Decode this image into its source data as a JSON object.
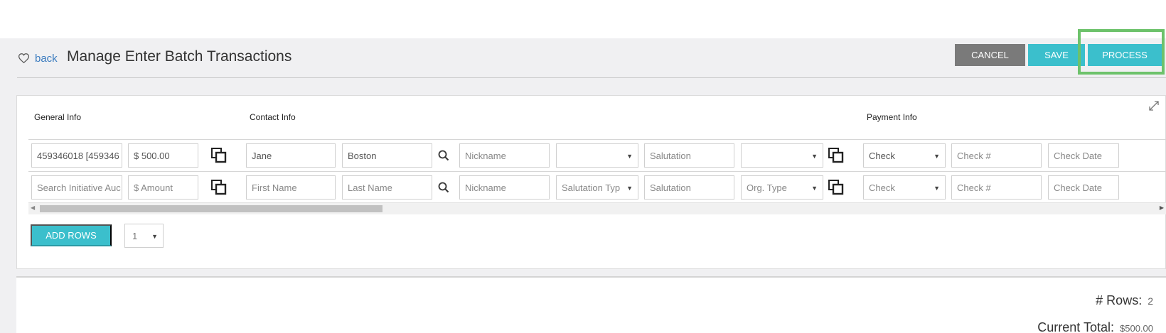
{
  "header": {
    "back_label": "back",
    "title": "Manage Enter Batch Transactions",
    "cancel_label": "CANCEL",
    "save_label": "SAVE",
    "process_label": "PROCESS"
  },
  "sections": {
    "general": "General Info",
    "contact": "Contact Info",
    "payment": "Payment Info"
  },
  "rows": [
    {
      "initiative": "459346018 [459346",
      "amount": "$ 500.00",
      "first_name": "Jane",
      "last_name": "Boston",
      "nickname": "Nickname",
      "salutation_type": "",
      "salutation": "Salutation",
      "org_type": "",
      "payment_type": "Check",
      "check_number": "Check #",
      "check_date": "Check Date"
    },
    {
      "initiative": "Search Initiative Auc",
      "amount": "$ Amount",
      "first_name": "First Name",
      "last_name": "Last Name",
      "nickname": "Nickname",
      "salutation_type": "Salutation Typ",
      "salutation": "Salutation",
      "org_type": "Org. Type",
      "payment_type": "Check",
      "check_number": "Check #",
      "check_date": "Check Date"
    }
  ],
  "add_rows_label": "ADD ROWS",
  "rows_to_add": "1",
  "summary": {
    "rows_label": "# Rows:",
    "rows_value": "2",
    "total_label": "Current Total:",
    "total_value": "$500.00"
  },
  "colors": {
    "accent": "#3bbfcc",
    "cancel": "#7a7a7a",
    "highlight": "#6dc26b",
    "link": "#3a7bbf"
  },
  "icons": [
    "heart-icon",
    "expand-icon",
    "copy-icon",
    "search-icon",
    "chevron-down-icon"
  ]
}
